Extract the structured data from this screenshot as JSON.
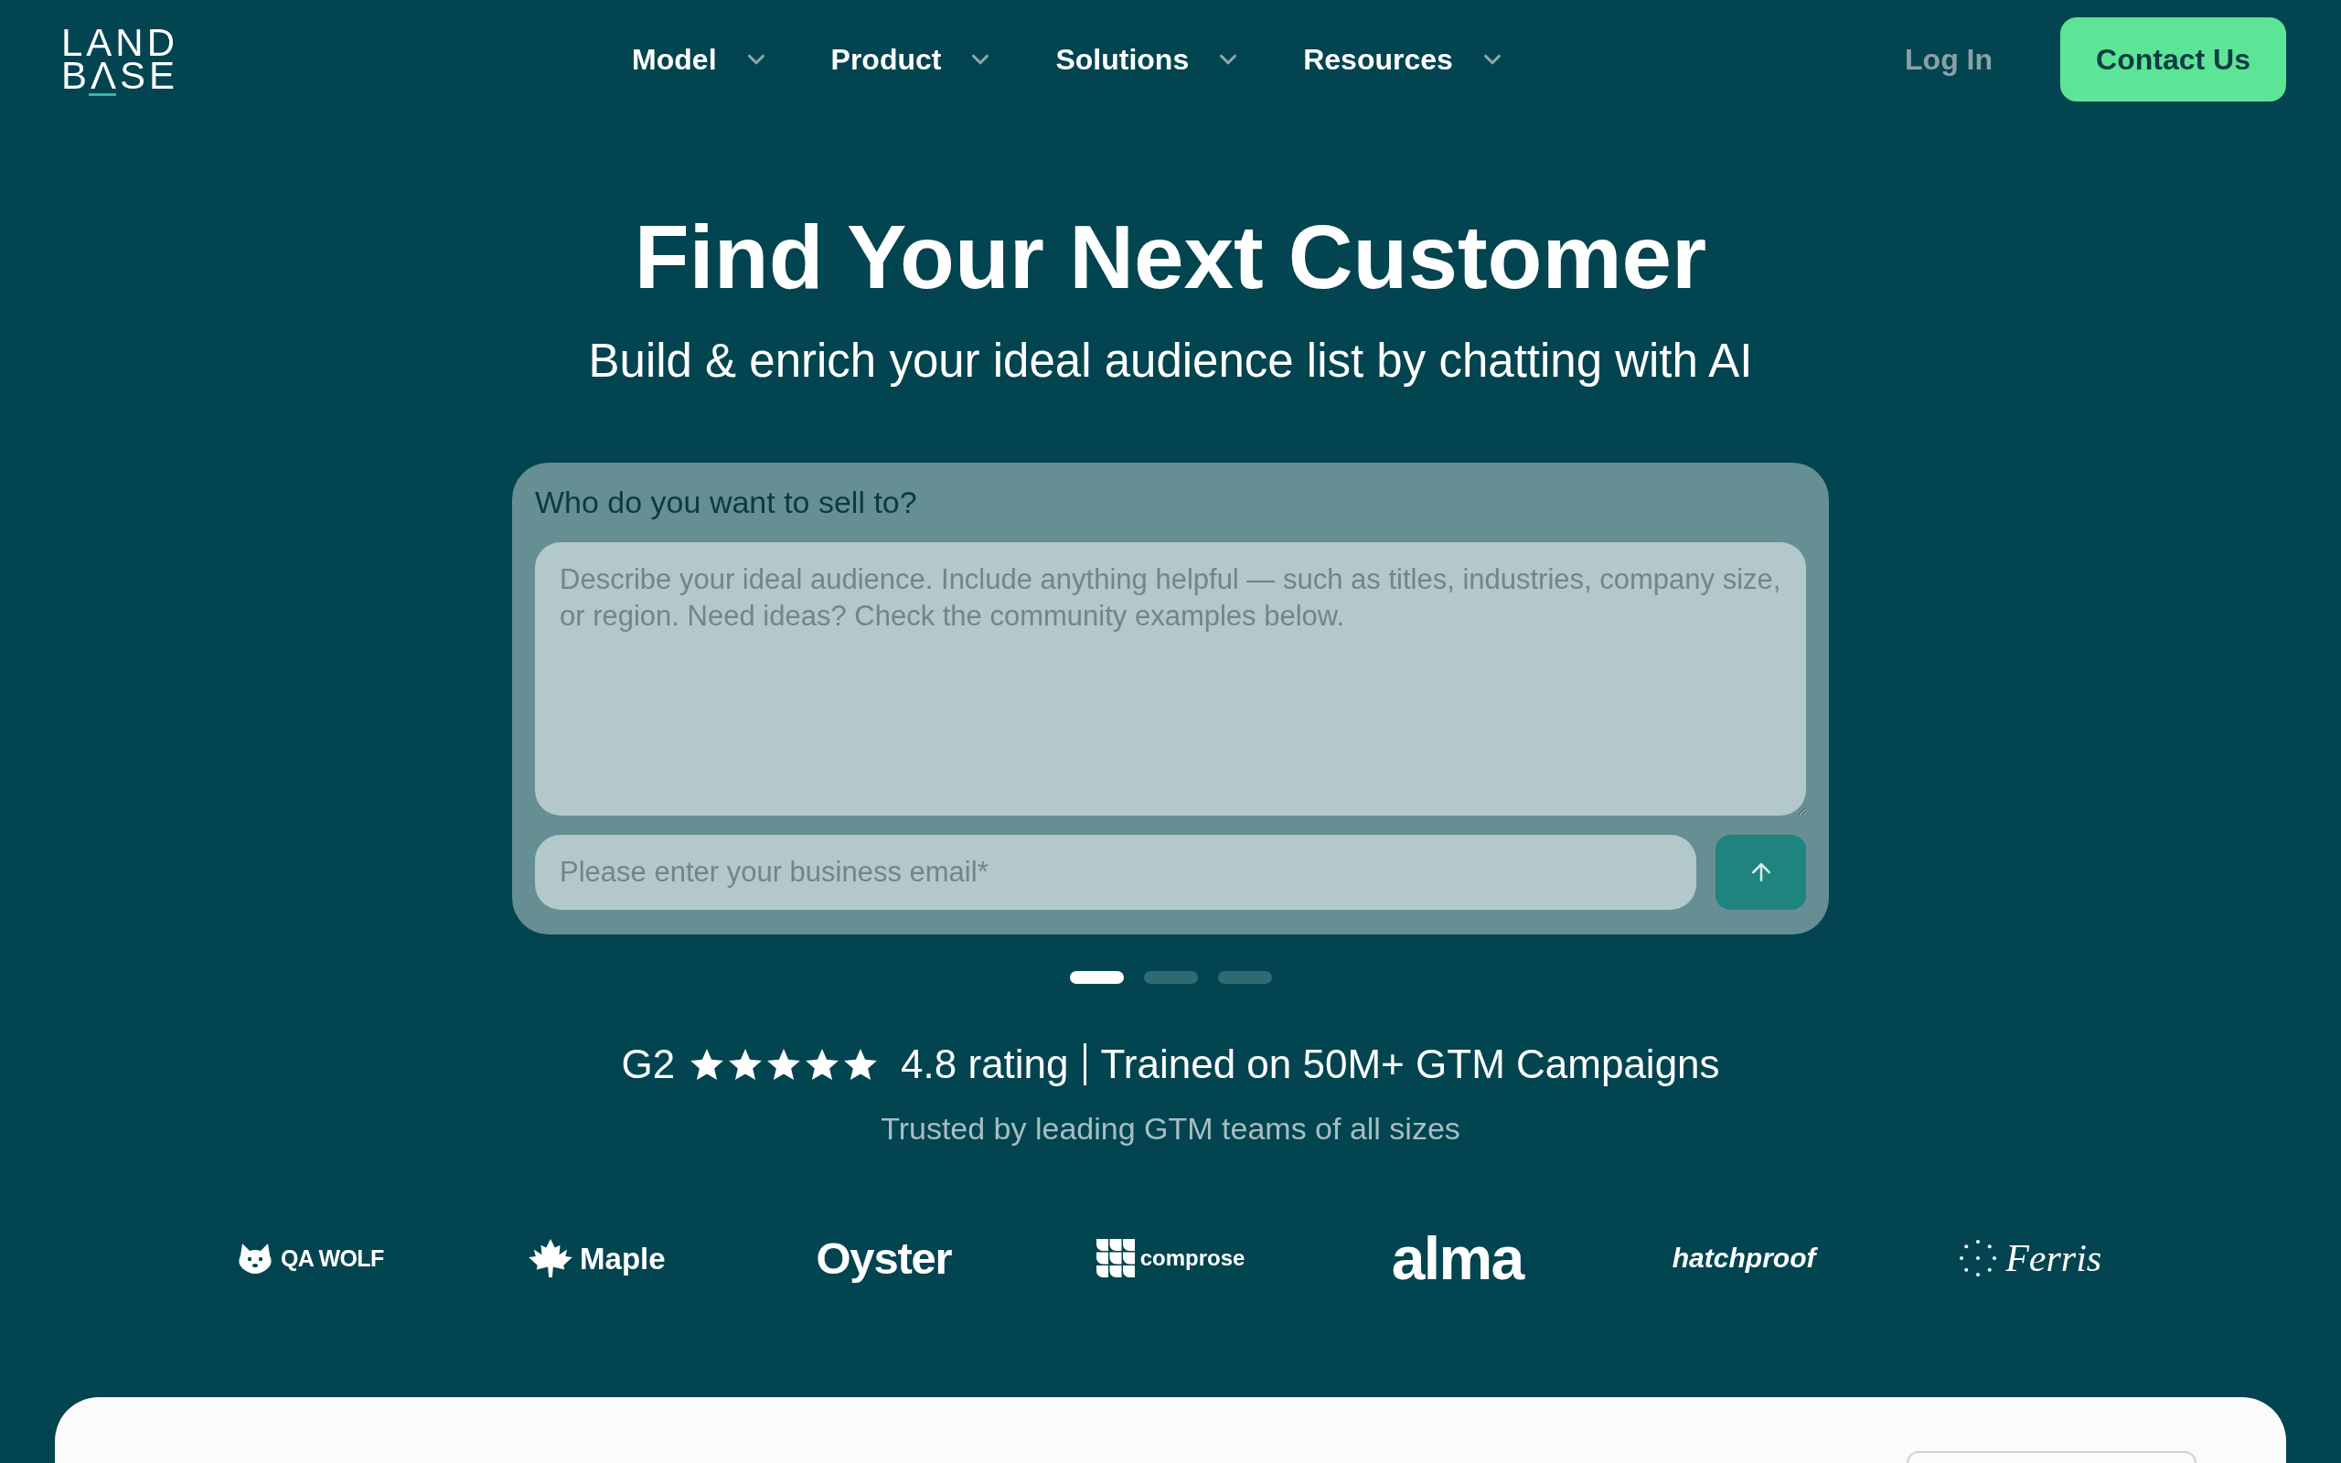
{
  "header": {
    "logo": {
      "lines": [
        "LAND",
        "BΛSE"
      ]
    },
    "nav": [
      {
        "label": "Model"
      },
      {
        "label": "Product"
      },
      {
        "label": "Solutions"
      },
      {
        "label": "Resources"
      }
    ],
    "login": "Log In",
    "cta": "Contact Us"
  },
  "hero": {
    "title": "Find Your Next Customer",
    "subtitle": "Build & enrich your ideal audience list by chatting with AI"
  },
  "prompt_card": {
    "label": "Who do you want to sell to?",
    "audience_field": {
      "placeholder": "Describe your ideal audience. Include anything helpful — such as titles, industries, company size, or region. Need ideas? Check the community examples below."
    },
    "email_field": {
      "placeholder": "Please enter your business email*"
    }
  },
  "carousel_dots": [
    {
      "selected": true
    },
    {
      "selected": false
    },
    {
      "selected": false
    }
  ],
  "rating": {
    "source": "G2",
    "stars": 5,
    "score": "4.8 rating",
    "claim": "Trained on 50M+ GTM Campaigns"
  },
  "trusted_caption": "Trusted by leading GTM teams of all sizes",
  "customer_logos": [
    {
      "name": "QA WOLF",
      "kind": "wolf"
    },
    {
      "name": "Maple",
      "kind": "leaf"
    },
    {
      "name": "Oyster",
      "kind": "rounded"
    },
    {
      "name": "comprose",
      "kind": "tiles"
    },
    {
      "name": "alma",
      "kind": "heavy"
    },
    {
      "name": "hatchproof",
      "kind": "italic"
    },
    {
      "name": "Ferris",
      "kind": "serif"
    }
  ]
}
